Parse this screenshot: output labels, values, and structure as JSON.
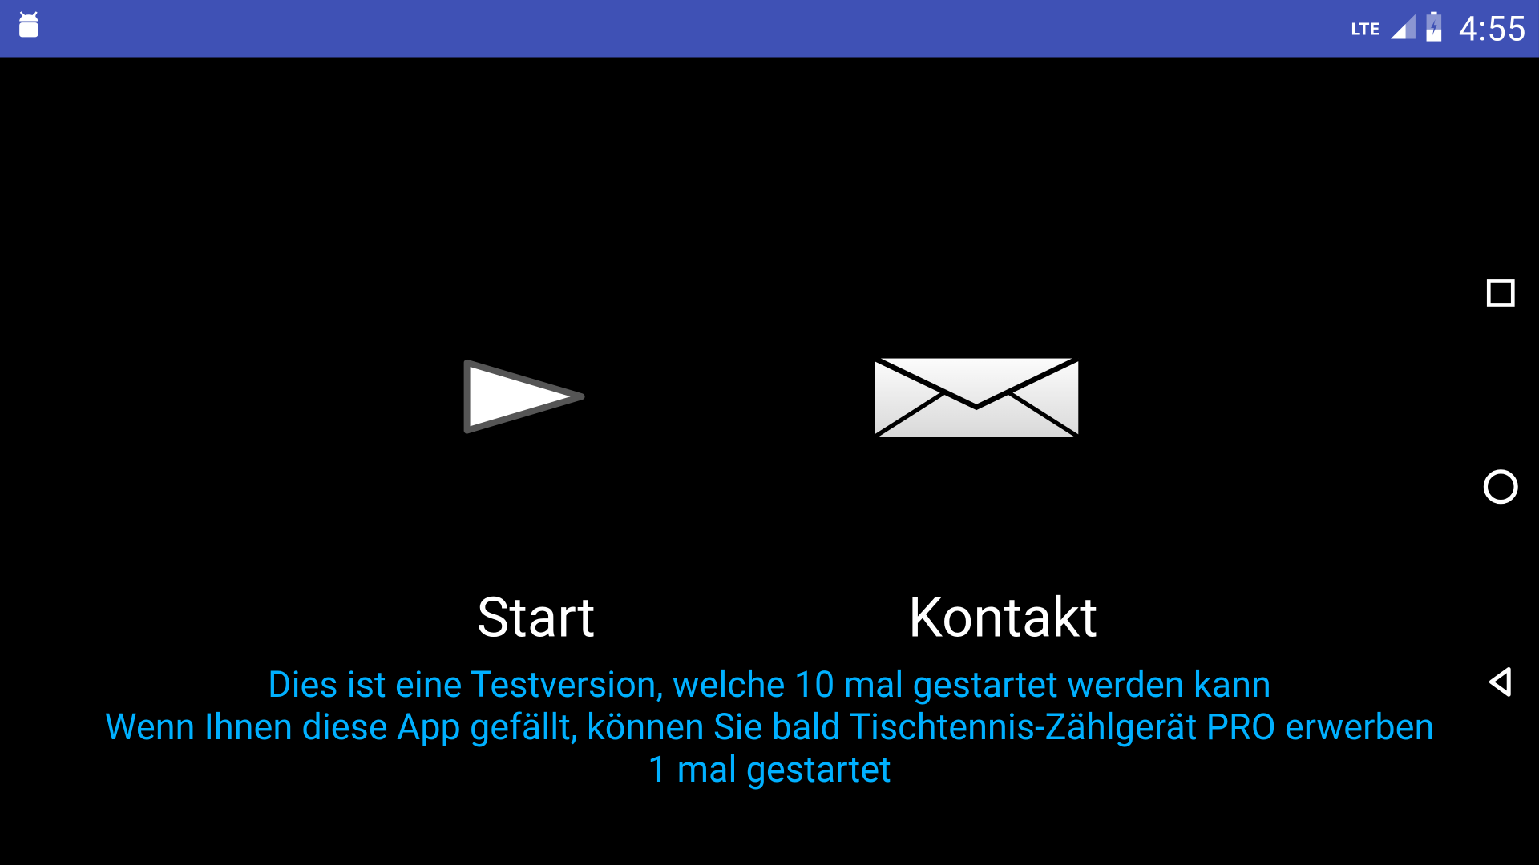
{
  "status": {
    "network": "LTE",
    "time": "4:55"
  },
  "main": {
    "start_label": "Start",
    "kontakt_label": "Kontakt",
    "info_line1": "Dies ist eine Testversion, welche 10 mal gestartet werden kann",
    "info_line2": "Wenn Ihnen diese App gefällt, können Sie bald Tischtennis-Zählgerät PRO erwerben",
    "info_line3": "1 mal gestartet"
  }
}
